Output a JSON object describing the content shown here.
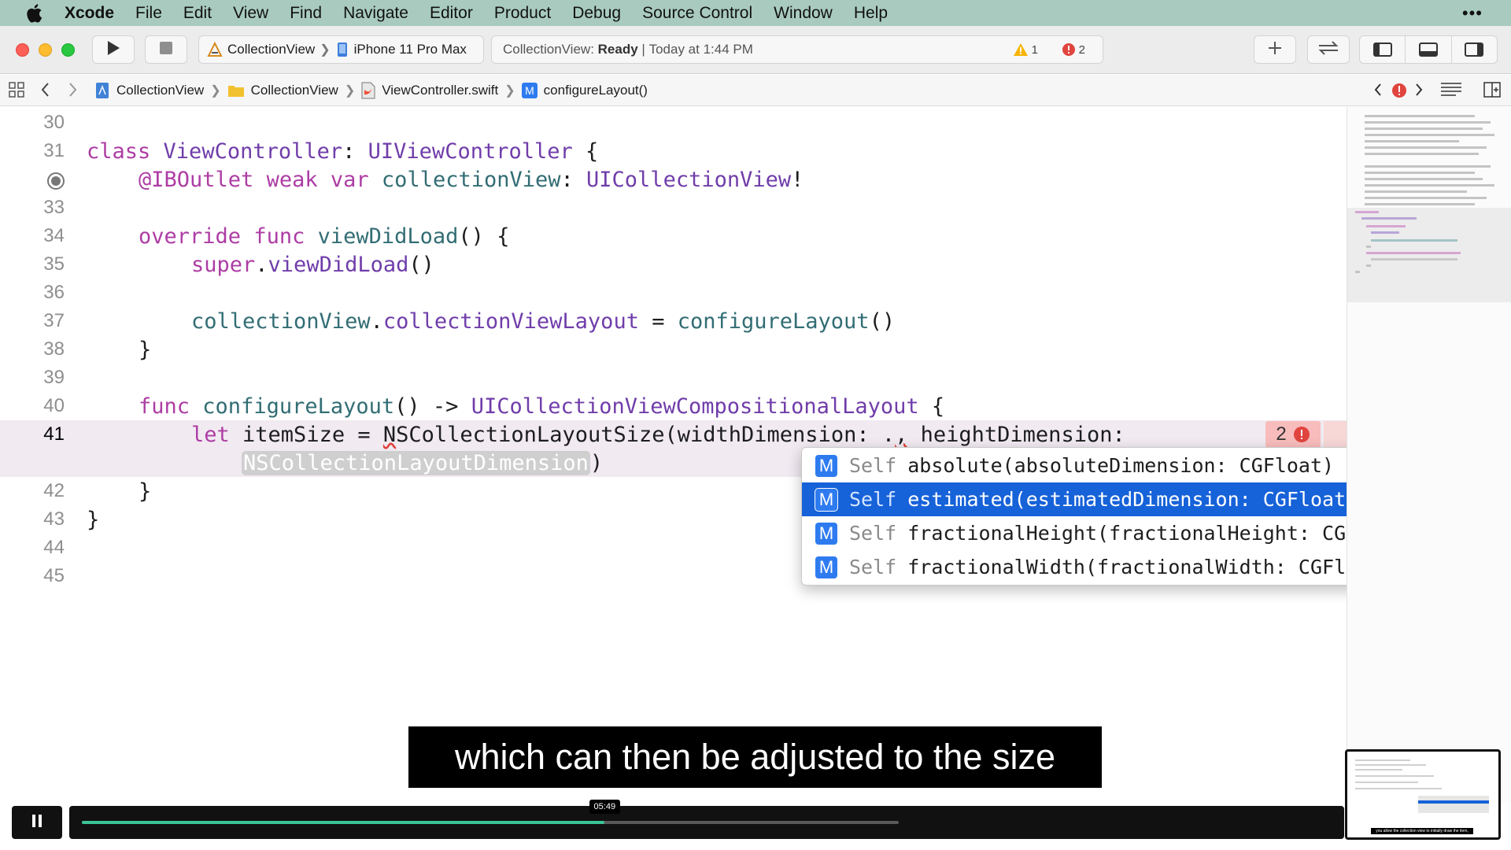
{
  "menubar": {
    "app": "Xcode",
    "items": [
      "File",
      "Edit",
      "View",
      "Find",
      "Navigate",
      "Editor",
      "Product",
      "Debug",
      "Source Control",
      "Window",
      "Help"
    ],
    "more": "•••"
  },
  "toolbar": {
    "scheme": "CollectionView",
    "device": "iPhone 11 Pro Max",
    "status_project": "CollectionView:",
    "status_state": "Ready",
    "status_separator": "|",
    "status_time": "Today at 1:44 PM",
    "warning_count": "1",
    "error_count": "2"
  },
  "jumpbar": {
    "crumbs": [
      "CollectionView",
      "CollectionView",
      "ViewController.swift",
      "configureLayout()"
    ]
  },
  "editor": {
    "line_numbers": [
      "30",
      "31",
      "33",
      "34",
      "35",
      "36",
      "37",
      "38",
      "39",
      "40",
      "41",
      "42",
      "43",
      "44",
      "45"
    ],
    "line31": {
      "kw": "class",
      "name": "ViewController",
      "colon": ":",
      "super": "UIViewController",
      "brace": "{"
    },
    "line32": {
      "attr": "@IBOutlet",
      "kw1": "weak",
      "kw2": "var",
      "name": "collectionView",
      "colon": ":",
      "type": "UICollectionView",
      "bang": "!"
    },
    "line34": {
      "kw1": "override",
      "kw2": "func",
      "name": "viewDidLoad",
      "rest": "() {"
    },
    "line35": {
      "kw": "super",
      "dot": ".",
      "name": "viewDidLoad",
      "rest": "()"
    },
    "line37": {
      "obj": "collectionView",
      "dot": ".",
      "prop": "collectionViewLayout",
      "eq": " = ",
      "call": "configureLayout",
      "rest": "()"
    },
    "line38": {
      "brace": "}"
    },
    "line40": {
      "kw": "func",
      "name": "configureLayout",
      "arrow": "() -> ",
      "type": "UICollectionViewCompositionalLayout",
      "brace": " {"
    },
    "line41": {
      "kw": "let",
      "var": " itemSize = ",
      "type_first": "N",
      "type_rest": "SCollectionLayoutSize",
      "args": "(widthDimension: .",
      "typed": ",",
      "after": " heightDimension:"
    },
    "line41b": {
      "placeholder": "NSCollectionLayoutDimension",
      "close": ")"
    },
    "line42": {
      "brace": "}"
    },
    "line43": {
      "brace": "}"
    },
    "error_badge_count": "2"
  },
  "autocomplete": {
    "items": [
      {
        "badge": "M",
        "type": "Self",
        "signature": "absolute(absoluteDimension: CGFloat)"
      },
      {
        "badge": "M",
        "type": "Self",
        "signature": "estimated(estimatedDimension: CGFloat)"
      },
      {
        "badge": "M",
        "type": "Self",
        "signature": "fractionalHeight(fractionalHeight: CGFloat)"
      },
      {
        "badge": "M",
        "type": "Self",
        "signature": "fractionalWidth(fractionalWidth: CGFloat)"
      }
    ],
    "selected_index": 1
  },
  "video": {
    "subtitle": "which can then be adjusted to the size",
    "time_tooltip": "05:49",
    "progress_fraction": 0.64,
    "preview_caption": "you allow the collection view to initially draw the item,"
  },
  "colors": {
    "menubar_bg": "#a9cbbf",
    "keyword": "#ad3da4",
    "type": "#703daa",
    "function": "#326d74",
    "selection": "#1662d9",
    "progress": "#39c594",
    "error": "#e0443e"
  }
}
